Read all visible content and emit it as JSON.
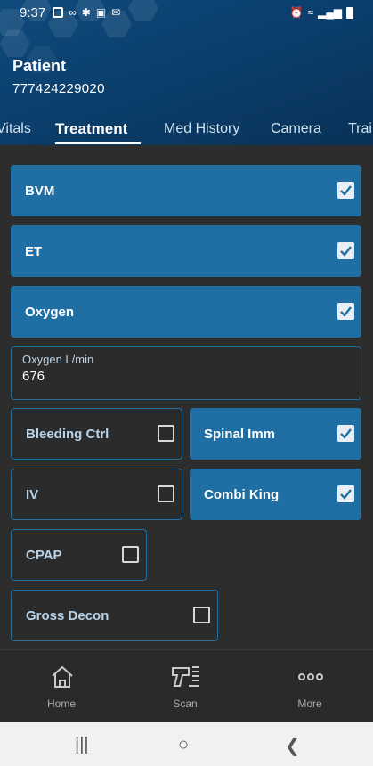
{
  "status_bar": {
    "time": "9:37"
  },
  "patient": {
    "title": "Patient",
    "id": "777424229020"
  },
  "tabs": [
    {
      "label": "Vitals"
    },
    {
      "label": "Treatment",
      "active": true
    },
    {
      "label": "Med History"
    },
    {
      "label": "Camera"
    },
    {
      "label": "Trai"
    }
  ],
  "treatments": {
    "bvm": {
      "label": "BVM",
      "checked": true
    },
    "et": {
      "label": "ET",
      "checked": true
    },
    "oxygen": {
      "label": "Oxygen",
      "checked": true
    },
    "bleeding_ctrl": {
      "label": "Bleeding Ctrl",
      "checked": false
    },
    "spinal_imm": {
      "label": "Spinal Imm",
      "checked": true
    },
    "iv": {
      "label": "IV",
      "checked": false
    },
    "combi_king": {
      "label": "Combi King",
      "checked": true
    },
    "cpap": {
      "label": "CPAP",
      "checked": false
    },
    "gross_decon": {
      "label": "Gross Decon",
      "checked": false
    }
  },
  "oxygen_field": {
    "label": "Oxygen L/min",
    "value": "676"
  },
  "bottom_nav": [
    {
      "label": "Home",
      "icon": "home-icon"
    },
    {
      "label": "Scan",
      "icon": "scanner-icon"
    },
    {
      "label": "More",
      "icon": "more-icon"
    }
  ],
  "colors": {
    "accent": "#1f6fa5",
    "header": "#0b3f6d",
    "background": "#2d2d2d"
  }
}
